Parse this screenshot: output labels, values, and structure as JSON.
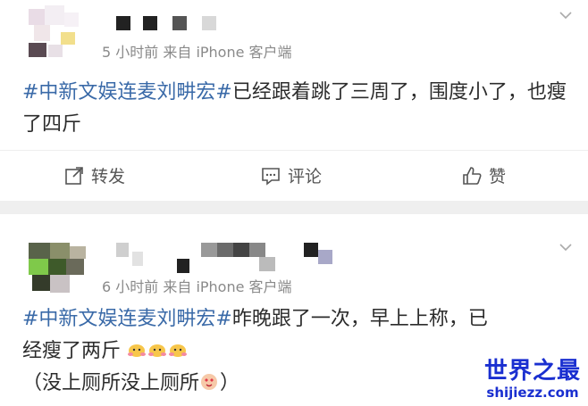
{
  "post1": {
    "meta": "5 小时前  来自 iPhone 客户端",
    "hashtag": "#中新文娱连麦刘畊宏#",
    "text": "已经跟着跳了三周了，围度小了，也瘦了四斤",
    "actions": {
      "repost": "转发",
      "comment": "评论",
      "like": "赞"
    }
  },
  "post2": {
    "meta": "6 小时前  来自 iPhone 客户端",
    "hashtag": "#中新文娱连麦刘畊宏#",
    "text_line1": "昨晚跟了一次，早上上称，已",
    "text_line2": "经瘦了两斤",
    "text_line3_open": "（没上厕所没上厕所",
    "text_line3_close": "）"
  },
  "watermark": {
    "title": "世界之最",
    "url": "shijiezz.com"
  },
  "colors": {
    "hashtag": "#3a6aa8",
    "meta": "#8a8a8a",
    "watermark": "#1a2fd0",
    "divider": "#efefef"
  },
  "icons": [
    "repost-icon",
    "comment-icon",
    "like-icon",
    "chevron-down-icon",
    "hamster-emoji",
    "love-face-emoji"
  ]
}
